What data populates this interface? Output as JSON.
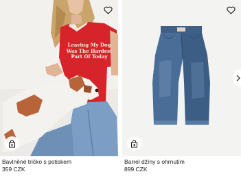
{
  "products": [
    {
      "name": "Bavlněné tričko s potiskem",
      "price": "359 CZK",
      "print_text": [
        "Leaving My Dog",
        "Was The Hardest",
        "Part Of Today"
      ]
    },
    {
      "name": "Barrel džíny s ohrnutím",
      "price": "899 CZK"
    }
  ],
  "icons": {
    "favorite": "heart-outline-icon",
    "add_to_bag": "shopping-bag-plus-icon",
    "next": "chevron-right-icon"
  },
  "colors": {
    "tshirt": "#d7242a",
    "denim": "#3d5e84",
    "photo_bg": "#eeeeec"
  }
}
